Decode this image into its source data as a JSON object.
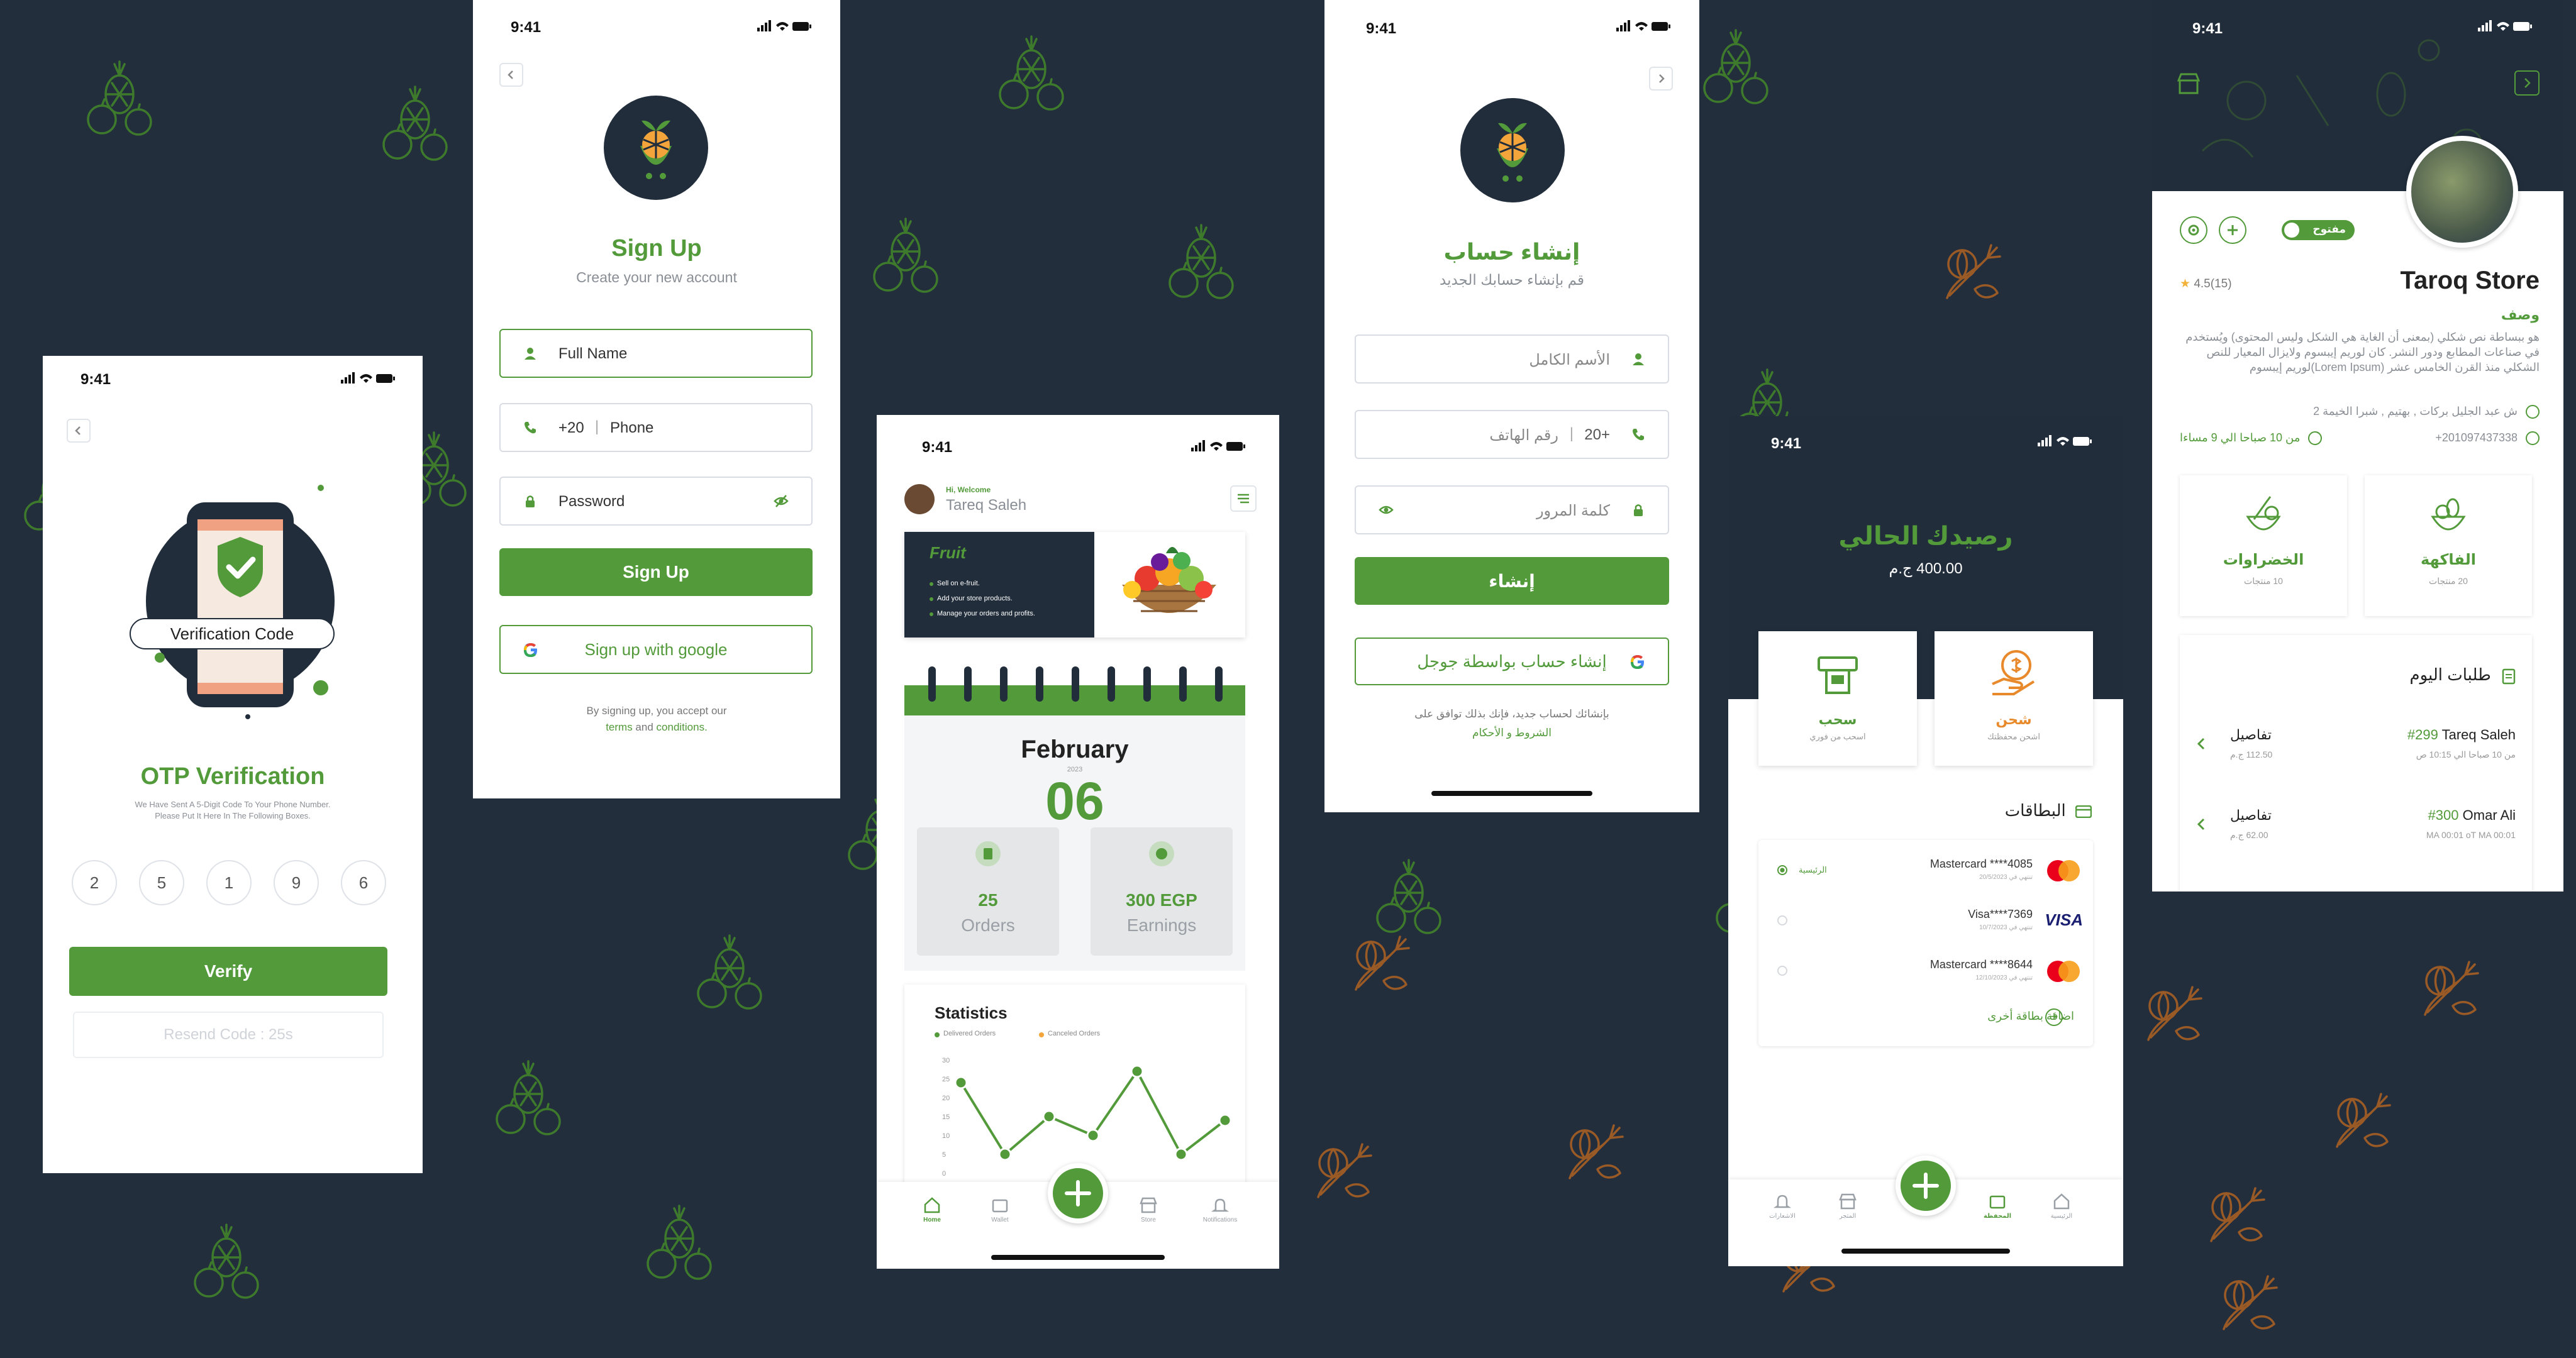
{
  "status_time": "9:41",
  "colors": {
    "background": "#232e3d",
    "accent": "#529a3a",
    "dark": "#212d3b",
    "muted": "#9aa0a6"
  },
  "otp": {
    "badge": "Verification Code",
    "title": "OTP Verification",
    "subtitle_1": "We Have Sent A 5-Digit Code To Your Phone Number.",
    "subtitle_2": "Please Put It Here In The Following Boxes.",
    "digits": [
      "2",
      "5",
      "1",
      "9",
      "6"
    ],
    "verify": "Verify",
    "resend": "Resend Code : 25s"
  },
  "signup": {
    "title": "Sign Up",
    "subtitle": "Create your new account",
    "name_placeholder": "Full Name",
    "country_code": "+20",
    "phone_placeholder": "Phone",
    "password_placeholder": "Password",
    "button": "Sign Up",
    "google": "Sign up with google",
    "terms_1": "By signing up, you accept our",
    "terms_link": "terms",
    "terms_and": "and",
    "conditions_link": "conditions."
  },
  "home": {
    "greeting": "Hi, Welcome",
    "user": "Tareq Saleh",
    "banner_brand": "Fruit",
    "banner_items": [
      "Sell on e-fruit.",
      "Add your store products.",
      "Manage your orders and profits."
    ],
    "month": "February",
    "year": "2023",
    "day": "06",
    "orders_value": "25",
    "orders_label": "Orders",
    "earnings_value": "300 EGP",
    "earnings_label": "Earnings",
    "stats_title": "Statistics",
    "legend_delivered": "Delivered Orders",
    "legend_canceled": "Canceled Orders",
    "nav": [
      "Home",
      "Wallet",
      "Store",
      "Notifications"
    ]
  },
  "chart_data": {
    "type": "line",
    "title": "Statistics",
    "y_ticks": [
      "30",
      "25",
      "20",
      "15",
      "10",
      "5",
      "0"
    ],
    "ylim": [
      0,
      30
    ],
    "series": [
      {
        "name": "Delivered Orders",
        "values": [
          24,
          5,
          15,
          10,
          27,
          5,
          14
        ]
      }
    ]
  },
  "signup_ar": {
    "title": "إنشاء حساب",
    "subtitle": "قم بإنشاء حسابك الجديد",
    "name_placeholder": "الأسم الكامل",
    "country_code": "+20",
    "phone_placeholder": "رقم الهاتف",
    "password_placeholder": "كلمة المرور",
    "button": "إنشاء",
    "google": "إنشاء حساب بواسطة جوجل",
    "terms_1": "بإنشائك لحساب جديد، فإنك بذلك توافق على",
    "terms_link": "الشروط و الأحكام"
  },
  "wallet": {
    "title": "رصيدك الحالي",
    "balance": "400.00 ج.م",
    "withdraw": "سحب",
    "withdraw_sub": "اسحب من فوري",
    "charge": "شحن",
    "charge_sub": "اشحن محفظتك",
    "cards_title": "البطاقات",
    "cards": [
      {
        "name": "Mastercard ****4085",
        "exp": "تنتهي في 20/5/2023",
        "tag": "الرئيسية",
        "brand": "mastercard"
      },
      {
        "name": "Visa****7369",
        "exp": "تنتهي في 10/7/2023",
        "tag": "",
        "brand": "visa"
      },
      {
        "name": "Mastercard ****8644",
        "exp": "تنتهي في 12/10/2023",
        "tag": "",
        "brand": "mastercard"
      }
    ],
    "add_card": "اضافة بطاقة أخرى",
    "nav": [
      "الرئيسية",
      "المحفظة",
      "المتجر",
      "الاشعارات"
    ]
  },
  "store": {
    "open": "مفتوح",
    "name": "Taroq Store",
    "rating": "4.5(15)",
    "desc_title": "وصف",
    "desc": "هو ببساطة نص شكلي (بمعنى أن الغاية هي الشكل وليس المحتوى) ويُستخدم في صناعات المطابع ودور النشر. كان لوريم إيبسوم ولايزال المعيار للنص الشكلي منذ القرن الخامس عشر",
    "desc_latin": "(Lorem Ipsum)لوريم إيبسوم",
    "address": "ش عبد الجليل بركات , بهتيم , شبرا الخيمة 2",
    "phone": "+201097437338",
    "hours": "من 10 صباحا الي 9 مساءا",
    "categories": [
      {
        "name": "الفاكهة",
        "count": "20 منتجات"
      },
      {
        "name": "الخضراوات",
        "count": "10 منتجات"
      }
    ],
    "orders_title": "طلبات اليوم",
    "orders": [
      {
        "id": "#299",
        "customer": "Tareq Saleh",
        "time": "من 10 صباحا الي 10:15 ص",
        "price": "112.50 ج.م",
        "details": "تفاصيل"
      },
      {
        "id": "#300",
        "customer": "Omar Ali",
        "time": "MA 00:01 oT MA 00:01",
        "price": "62.00 ج.م",
        "details": "تفاصيل"
      }
    ]
  }
}
